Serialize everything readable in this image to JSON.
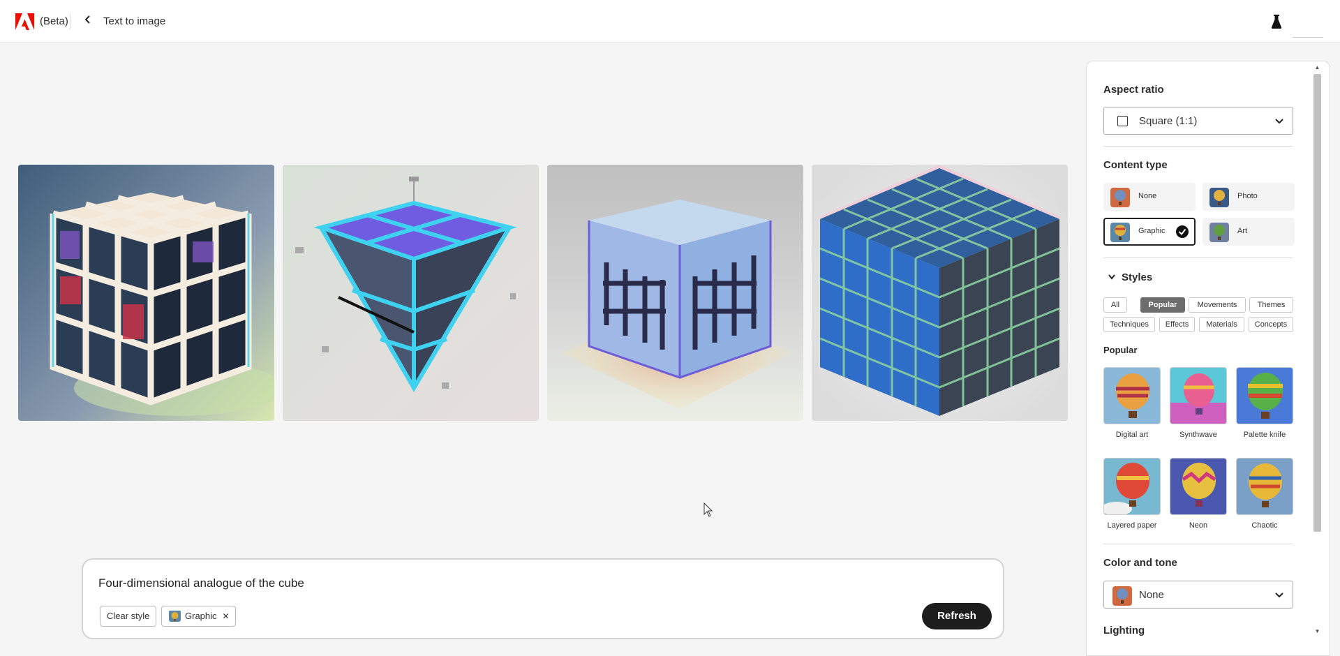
{
  "header": {
    "beta_label": "(Beta)",
    "title": "Text to image",
    "brand_color": "#eb1000"
  },
  "gallery": {
    "images": [
      {
        "name": "generated-image-1"
      },
      {
        "name": "generated-image-2"
      },
      {
        "name": "generated-image-3"
      },
      {
        "name": "generated-image-4"
      }
    ]
  },
  "prompt": {
    "text": "Four-dimensional analogue of the cube",
    "clear_style_label": "Clear style",
    "applied_style_label": "Graphic",
    "refresh_label": "Refresh"
  },
  "panel": {
    "aspect_ratio": {
      "title": "Aspect ratio",
      "value": "Square (1:1)"
    },
    "content_type": {
      "title": "Content type",
      "options": [
        {
          "label": "None",
          "selected": false
        },
        {
          "label": "Photo",
          "selected": false
        },
        {
          "label": "Graphic",
          "selected": true
        },
        {
          "label": "Art",
          "selected": false
        }
      ]
    },
    "styles": {
      "title": "Styles",
      "tags": [
        "All",
        "Popular",
        "Movements",
        "Themes",
        "Techniques",
        "Effects",
        "Materials",
        "Concepts"
      ],
      "active_tag": "Popular",
      "section_title": "Popular",
      "items": [
        "Digital art",
        "Synthwave",
        "Palette knife",
        "Layered paper",
        "Neon",
        "Chaotic"
      ]
    },
    "color_and_tone": {
      "title": "Color and tone",
      "value": "None"
    },
    "lighting": {
      "title": "Lighting"
    }
  }
}
